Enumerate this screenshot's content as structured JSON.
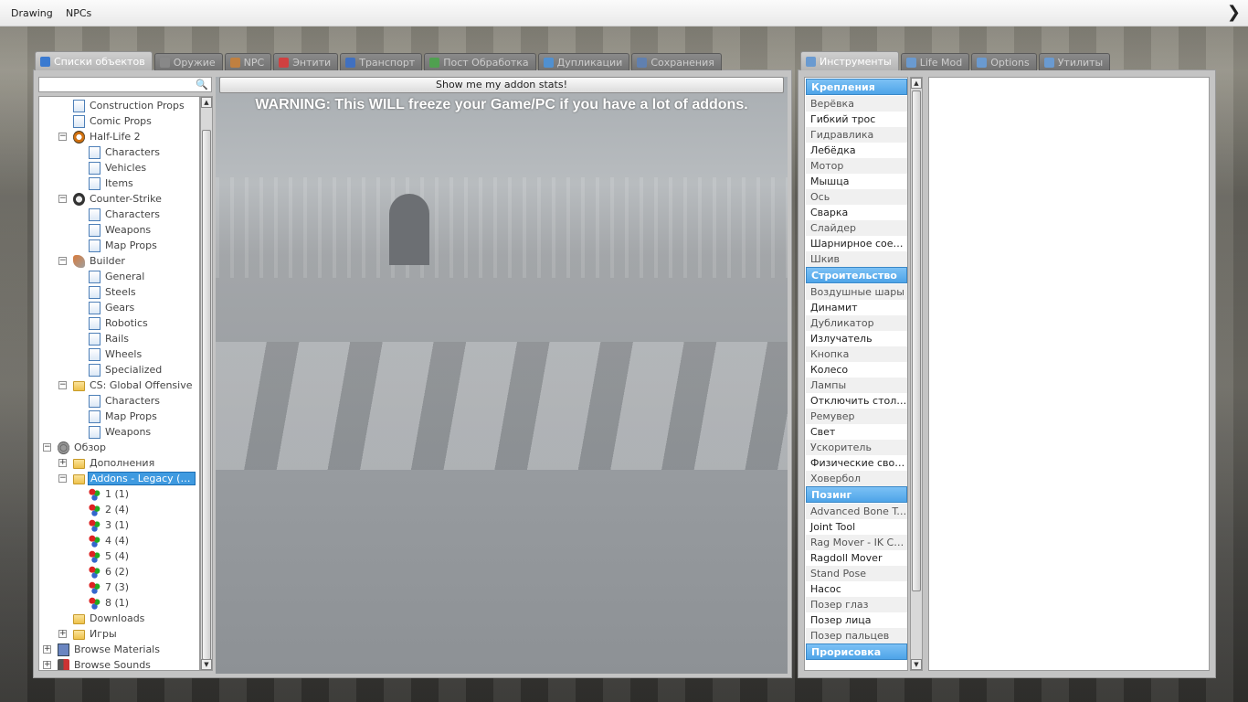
{
  "topbar": {
    "menu": [
      "Drawing",
      "NPCs"
    ],
    "arrow": "❯"
  },
  "spawn_tabs": [
    {
      "label": "Списки объектов",
      "active": true,
      "color": "#3a7ad0"
    },
    {
      "label": "Оружие",
      "color": "#888"
    },
    {
      "label": "NPC",
      "color": "#c08040"
    },
    {
      "label": "Энтити",
      "color": "#d04040"
    },
    {
      "label": "Транспорт",
      "color": "#4070c0"
    },
    {
      "label": "Пост Обработка",
      "color": "#50a050"
    },
    {
      "label": "Дупликации",
      "color": "#5090d0"
    },
    {
      "label": "Сохранения",
      "color": "#6080b0"
    }
  ],
  "tool_tabs": [
    {
      "label": "Инструменты",
      "active": true
    },
    {
      "label": "Life Mod"
    },
    {
      "label": "Options"
    },
    {
      "label": "Утилиты"
    }
  ],
  "search": {
    "placeholder": "",
    "icon": "search-icon"
  },
  "tree": [
    {
      "label": "Construction Props",
      "indent": 2,
      "icon": "page"
    },
    {
      "label": "Comic Props",
      "indent": 2,
      "icon": "page"
    },
    {
      "label": "Half-Life 2",
      "indent": 2,
      "icon": "hl2",
      "exp": "−"
    },
    {
      "label": "Characters",
      "indent": 3,
      "icon": "page"
    },
    {
      "label": "Vehicles",
      "indent": 3,
      "icon": "page"
    },
    {
      "label": "Items",
      "indent": 3,
      "icon": "page"
    },
    {
      "label": "Counter-Strike",
      "indent": 2,
      "icon": "cs",
      "exp": "−"
    },
    {
      "label": "Characters",
      "indent": 3,
      "icon": "page"
    },
    {
      "label": "Weapons",
      "indent": 3,
      "icon": "page"
    },
    {
      "label": "Map Props",
      "indent": 3,
      "icon": "page"
    },
    {
      "label": "Builder",
      "indent": 2,
      "icon": "wrench",
      "exp": "−"
    },
    {
      "label": "General",
      "indent": 3,
      "icon": "page"
    },
    {
      "label": "Steels",
      "indent": 3,
      "icon": "page"
    },
    {
      "label": "Gears",
      "indent": 3,
      "icon": "page"
    },
    {
      "label": "Robotics",
      "indent": 3,
      "icon": "page"
    },
    {
      "label": "Rails",
      "indent": 3,
      "icon": "page"
    },
    {
      "label": "Wheels",
      "indent": 3,
      "icon": "page"
    },
    {
      "label": "Specialized",
      "indent": 3,
      "icon": "page"
    },
    {
      "label": "CS: Global Offensive",
      "indent": 2,
      "icon": "folder",
      "exp": "−"
    },
    {
      "label": "Characters",
      "indent": 3,
      "icon": "page"
    },
    {
      "label": "Map Props",
      "indent": 3,
      "icon": "page"
    },
    {
      "label": "Weapons",
      "indent": 3,
      "icon": "page"
    },
    {
      "label": "Обзор",
      "indent": 1,
      "icon": "gear",
      "exp": "−"
    },
    {
      "label": "Дополнения",
      "indent": 2,
      "icon": "folder",
      "exp": "+"
    },
    {
      "label": "Addons - Legacy ( Inf…",
      "indent": 2,
      "icon": "folder",
      "exp": "−",
      "selected": true
    },
    {
      "label": "1 (1)",
      "indent": 3,
      "icon": "gems"
    },
    {
      "label": "2 (4)",
      "indent": 3,
      "icon": "gems"
    },
    {
      "label": "3 (1)",
      "indent": 3,
      "icon": "gems"
    },
    {
      "label": "4 (4)",
      "indent": 3,
      "icon": "gems"
    },
    {
      "label": "5 (4)",
      "indent": 3,
      "icon": "gems"
    },
    {
      "label": "6 (2)",
      "indent": 3,
      "icon": "gems"
    },
    {
      "label": "7 (3)",
      "indent": 3,
      "icon": "gems"
    },
    {
      "label": "8 (1)",
      "indent": 3,
      "icon": "gems"
    },
    {
      "label": "Downloads",
      "indent": 2,
      "icon": "folder"
    },
    {
      "label": "Игры",
      "indent": 2,
      "icon": "folder",
      "exp": "+"
    },
    {
      "label": "Browse Materials",
      "indent": 1,
      "icon": "mat",
      "exp": "+"
    },
    {
      "label": "Browse Sounds",
      "indent": 1,
      "icon": "snd",
      "exp": "+"
    }
  ],
  "content": {
    "addon_button": "Show me my addon stats!",
    "warning": "WARNING: This WILL freeze your Game/PC if you have a lot of addons."
  },
  "tool_list": [
    {
      "type": "cat",
      "label": "Крепления"
    },
    {
      "label": "Верёвка"
    },
    {
      "label": "Гибкий трос",
      "dark": true
    },
    {
      "label": "Гидравлика"
    },
    {
      "label": "Лебёдка",
      "dark": true
    },
    {
      "label": "Мотор"
    },
    {
      "label": "Мышца",
      "dark": true
    },
    {
      "label": "Ось"
    },
    {
      "label": "Сварка",
      "dark": true
    },
    {
      "label": "Слайдер"
    },
    {
      "label": "Шарнирное соеди…",
      "dark": true
    },
    {
      "label": "Шкив"
    },
    {
      "type": "cat",
      "label": "Строительство"
    },
    {
      "label": "Воздушные шары"
    },
    {
      "label": "Динамит",
      "dark": true
    },
    {
      "label": "Дубликатор"
    },
    {
      "label": "Излучатель",
      "dark": true
    },
    {
      "label": "Кнопка"
    },
    {
      "label": "Колесо",
      "dark": true
    },
    {
      "label": "Лампы"
    },
    {
      "label": "Отключить столк…",
      "dark": true
    },
    {
      "label": "Ремувер"
    },
    {
      "label": "Свет",
      "dark": true
    },
    {
      "label": "Ускоритель"
    },
    {
      "label": "Физические свойс…",
      "dark": true
    },
    {
      "label": "Ховербол"
    },
    {
      "type": "cat",
      "label": "Позинг"
    },
    {
      "label": "Advanced Bone Tool"
    },
    {
      "label": "Joint Tool",
      "dark": true
    },
    {
      "label": "Rag Mover - IK Ch…"
    },
    {
      "label": "Ragdoll Mover",
      "dark": true
    },
    {
      "label": "Stand Pose"
    },
    {
      "label": "Насос",
      "dark": true
    },
    {
      "label": "Позер глаз"
    },
    {
      "label": "Позер лица",
      "dark": true
    },
    {
      "label": "Позер пальцев"
    },
    {
      "type": "cat",
      "label": "Прорисовка"
    }
  ]
}
